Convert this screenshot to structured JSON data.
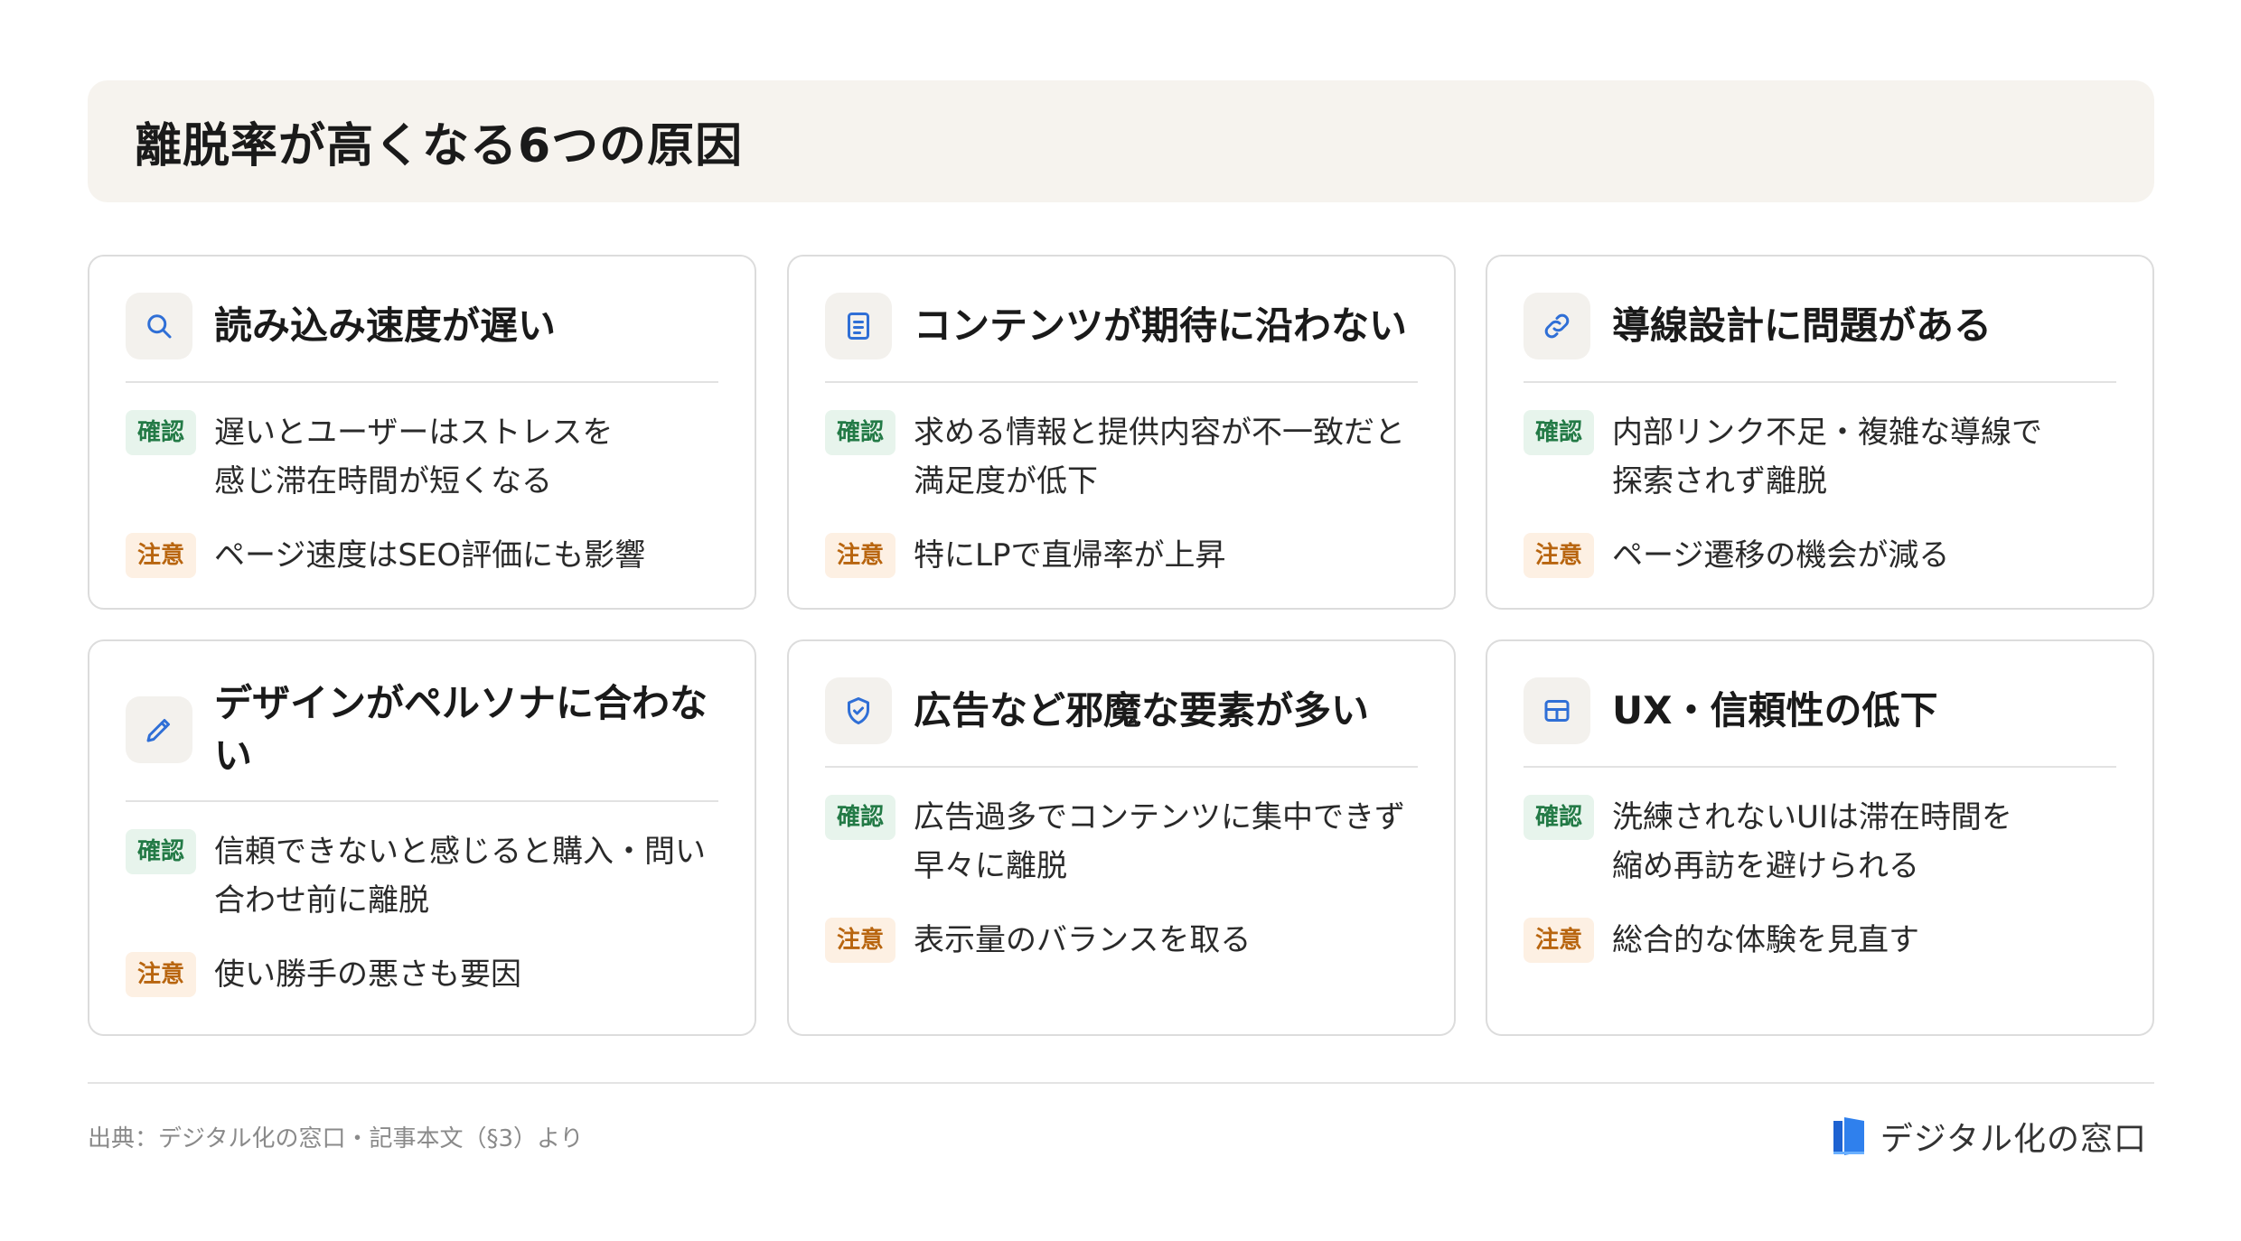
{
  "header": {
    "title": "離脱率が高くなる6つの原因"
  },
  "badges": {
    "check": "確認",
    "note": "注意"
  },
  "cards": [
    {
      "title": "読み込み速度が遅い",
      "icon": "search-icon",
      "check_lines": [
        "遅いとユーザーはストレスを",
        "感じ滞在時間が短くなる"
      ],
      "note": "ページ速度はSEO評価にも影響"
    },
    {
      "title": "コンテンツが期待に沿わない",
      "icon": "document-icon",
      "check_lines": [
        "求める情報と提供内容が不一致だと",
        "満足度が低下"
      ],
      "note": "特にLPで直帰率が上昇"
    },
    {
      "title": "導線設計に問題がある",
      "icon": "link-icon",
      "check_lines": [
        "内部リンク不足・複雑な導線で",
        "探索されず離脱"
      ],
      "note": "ページ遷移の機会が減る"
    },
    {
      "title_lines": [
        "デザインがペルソナに合わな",
        "い"
      ],
      "icon": "pencil-icon",
      "check_lines": [
        "信頼できないと感じると購入・問い",
        "合わせ前に離脱"
      ],
      "note": "使い勝手の悪さも要因"
    },
    {
      "title": "広告など邪魔な要素が多い",
      "icon": "shield-check-icon",
      "check_lines": [
        "広告過多でコンテンツに集中できず",
        "早々に離脱"
      ],
      "note": "表示量のバランスを取る"
    },
    {
      "title": "UX・信頼性の低下",
      "icon": "layout-icon",
      "check_lines": [
        "洗練されないUIは滞在時間を",
        "縮め再訪を避けられる"
      ],
      "note": "総合的な体験を見直す"
    }
  ],
  "footer": {
    "source": "出典：デジタル化の窓口・記事本文（§3）より",
    "logo_text": "デジタル化の窓口"
  },
  "colors": {
    "accent_icon": "#2f6fd6",
    "check_badge_bg": "#e7f4ec",
    "check_badge_text": "#237a46",
    "note_badge_bg": "#fdf0e3",
    "note_badge_text": "#b8650f",
    "header_bg": "#f6f3ee"
  }
}
